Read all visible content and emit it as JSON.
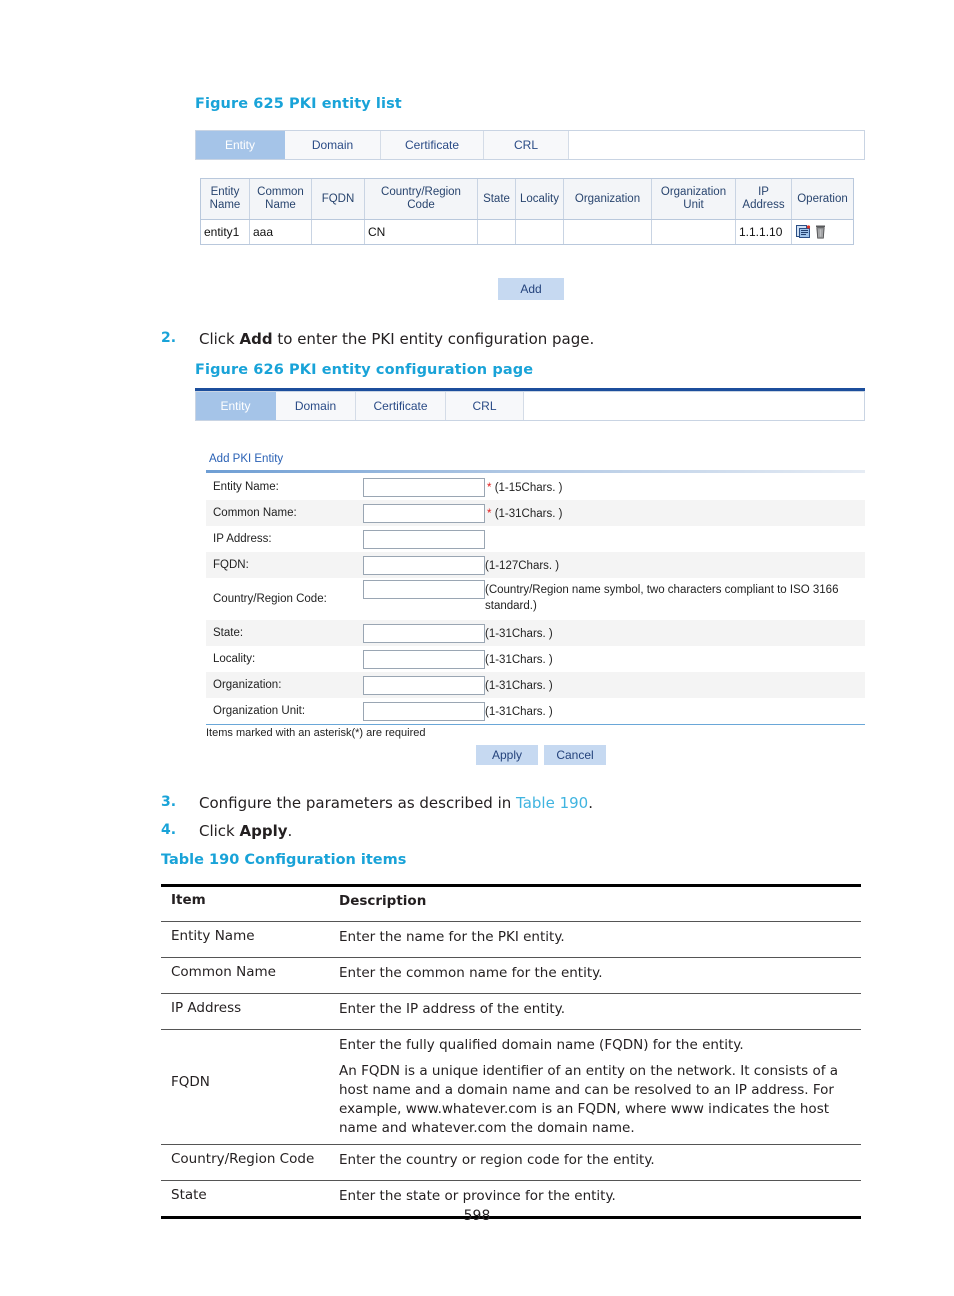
{
  "page": {
    "number": "598"
  },
  "figure625": {
    "caption": "Figure 625 PKI entity list",
    "tabs": [
      {
        "label": "Entity",
        "active": true
      },
      {
        "label": "Domain",
        "active": false
      },
      {
        "label": "Certificate",
        "active": false
      },
      {
        "label": "CRL",
        "active": false
      }
    ],
    "table": {
      "headers": [
        "Entity Name",
        "Common Name",
        "FQDN",
        "Country/Region Code",
        "State",
        "Locality",
        "Organization",
        "Organization Unit",
        "IP Address",
        "Operation"
      ],
      "rows": [
        {
          "entity_name": "entity1",
          "common_name": "aaa",
          "fqdn": "",
          "country_region_code": "CN",
          "state": "",
          "locality": "",
          "organization": "",
          "organization_unit": "",
          "ip_address": "1.1.1.10",
          "operation_icons": [
            "edit-entity-icon",
            "delete-entity-icon"
          ]
        }
      ]
    },
    "add_button": "Add"
  },
  "steps": {
    "step2": {
      "number": "2.",
      "text_before": "Click ",
      "bold": "Add",
      "text_after": " to enter the PKI entity configuration page."
    },
    "step3": {
      "number": "3.",
      "text_before": "Configure the parameters as described in ",
      "link": "Table 190",
      "text_after": "."
    },
    "step4": {
      "number": "4.",
      "text_before": "Click ",
      "bold": "Apply",
      "text_after": "."
    }
  },
  "figure626": {
    "caption": "Figure 626 PKI entity configuration page",
    "tabs": [
      {
        "label": "Entity",
        "active": true
      },
      {
        "label": "Domain",
        "active": false
      },
      {
        "label": "Certificate",
        "active": false
      },
      {
        "label": "CRL",
        "active": false
      }
    ],
    "section_title": "Add PKI Entity",
    "fields": [
      {
        "label": "Entity Name:",
        "value": "",
        "required": true,
        "hint": "(1-15Chars. )"
      },
      {
        "label": "Common Name:",
        "value": "",
        "required": true,
        "hint": "(1-31Chars. )"
      },
      {
        "label": "IP Address:",
        "value": "",
        "required": false,
        "hint": ""
      },
      {
        "label": "FQDN:",
        "value": "",
        "required": false,
        "hint": "(1-127Chars. )"
      },
      {
        "label": "Country/Region Code:",
        "value": "",
        "required": false,
        "hint": "(Country/Region name symbol, two characters compliant to ISO 3166 standard.)"
      },
      {
        "label": "State:",
        "value": "",
        "required": false,
        "hint": "(1-31Chars. )"
      },
      {
        "label": "Locality:",
        "value": "",
        "required": false,
        "hint": "(1-31Chars. )"
      },
      {
        "label": "Organization:",
        "value": "",
        "required": false,
        "hint": "(1-31Chars. )"
      },
      {
        "label": "Organization Unit:",
        "value": "",
        "required": false,
        "hint": "(1-31Chars. )"
      }
    ],
    "footnote": "Items marked with an asterisk(*) are required",
    "apply_button": "Apply",
    "cancel_button": "Cancel"
  },
  "table190": {
    "caption": "Table 190 Configuration items",
    "headers": {
      "item": "Item",
      "description": "Description"
    },
    "rows": [
      {
        "item": "Entity Name",
        "description": "Enter the name for the PKI entity."
      },
      {
        "item": "Common Name",
        "description": "Enter the common name for the entity."
      },
      {
        "item": "IP Address",
        "description": "Enter the IP address of the entity."
      },
      {
        "item": "FQDN",
        "description": "Enter the fully qualified domain name (FQDN) for the entity.",
        "description2": "An FQDN is a unique identifier of an entity on the network. It consists of a host name and a domain name and can be resolved to an IP address. For example, www.whatever.com is an FQDN, where www indicates the host name and whatever.com the domain name."
      },
      {
        "item": "Country/Region Code",
        "description": "Enter the country or region code for the entity."
      },
      {
        "item": "State",
        "description": "Enter the state or province for the entity."
      }
    ]
  },
  "colors": {
    "heading_blue": "#19a3d8",
    "link_blue": "#3fb4e0",
    "tab_active": "#a5c4e8",
    "button_blue": "#c6d9f1",
    "required_red": "#e02020"
  }
}
